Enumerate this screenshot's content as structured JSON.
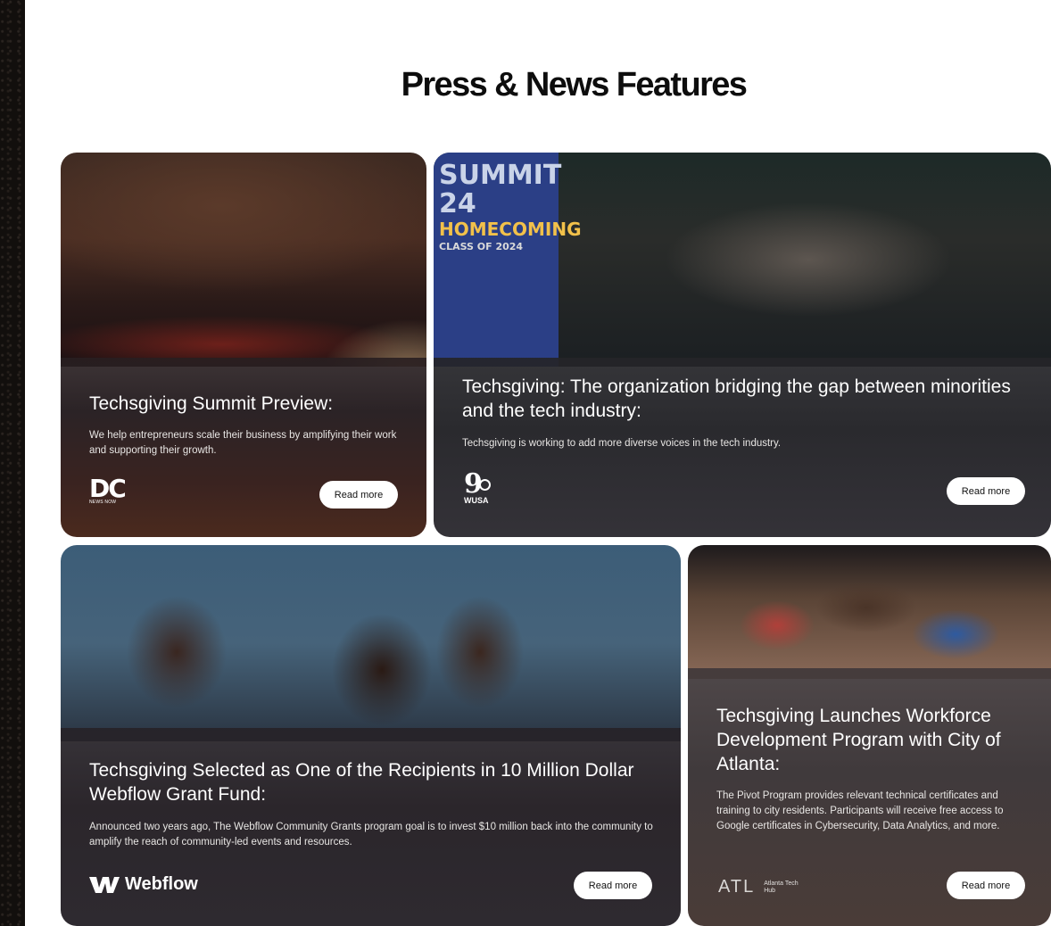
{
  "page_title": "Press & News Features",
  "cards": [
    {
      "title": "Techsgiving Summit Preview:",
      "description": "We help entrepreneurs scale their business by amplifying their work and supporting their growth.",
      "button": "Read more",
      "logo": {
        "main": "DC",
        "sub": "NEWS NOW",
        "icon": "dc-news-now-logo"
      }
    },
    {
      "title": "Techsgiving: The organization bridging the gap between minorities and the tech industry:",
      "description": "Techsgiving is working to add more diverse voices in the tech industry.",
      "button": "Read more",
      "logo": {
        "main": "9",
        "sub": "WUSA",
        "icon": "wusa9-logo"
      },
      "photo_sign": {
        "line1": "SUMMIT 24",
        "line2": "HOMECOMING",
        "line3": "CLASS OF 2024"
      }
    },
    {
      "title": "Techsgiving Selected as One of the Recipients in 10 Million Dollar Webflow Grant Fund:",
      "description": "Announced two years ago, The Webflow Community Grants program goal is to invest $10 million back into the community to amplify the reach of community-led events and resources.",
      "button": "Read more",
      "logo": {
        "main": "Webflow",
        "icon": "webflow-logo"
      }
    },
    {
      "title": "Techsgiving Launches Workforce Development Program with City of Atlanta:",
      "description": "The Pivot Program provides relevant technical certificates and training to city residents. Participants will receive free access to Google certificates in Cybersecurity, Data Analytics, and more.",
      "button": "Read more",
      "logo": {
        "main": "ATL",
        "sub": "Atlanta Tech Hub",
        "icon": "atlanta-tech-hub-logo"
      }
    }
  ]
}
